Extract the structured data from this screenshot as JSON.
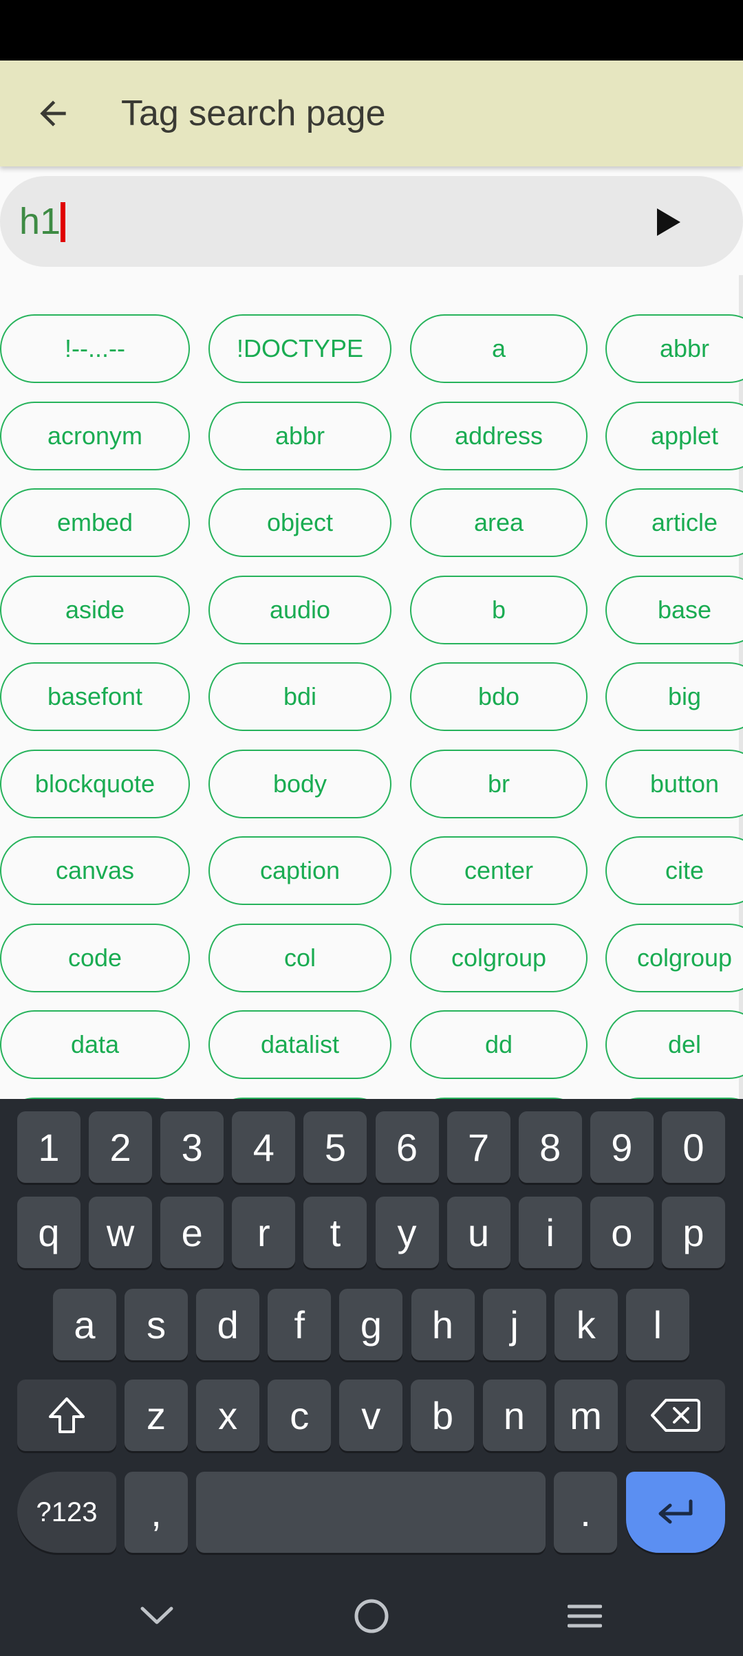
{
  "app_bar": {
    "title": "Tag search page",
    "back_icon": "arrow-left-icon"
  },
  "search": {
    "value": "h1",
    "submit_icon": "play-icon"
  },
  "tags": [
    "!--...--",
    "!DOCTYPE",
    "a",
    "abbr",
    "acronym",
    "abbr",
    "address",
    "applet",
    "embed",
    "object",
    "area",
    "article",
    "aside",
    "audio",
    "b",
    "base",
    "basefont",
    "bdi",
    "bdo",
    "big",
    "blockquote",
    "body",
    "br",
    "button",
    "canvas",
    "caption",
    "center",
    "cite",
    "code",
    "col",
    "colgroup",
    "colgroup",
    "data",
    "datalist",
    "dd",
    "del"
  ],
  "keyboard": {
    "row_numbers": [
      "1",
      "2",
      "3",
      "4",
      "5",
      "6",
      "7",
      "8",
      "9",
      "0"
    ],
    "row_1": [
      "q",
      "w",
      "e",
      "r",
      "t",
      "y",
      "u",
      "i",
      "o",
      "p"
    ],
    "row_2": [
      "a",
      "s",
      "d",
      "f",
      "g",
      "h",
      "j",
      "k",
      "l"
    ],
    "row_3": [
      "z",
      "x",
      "c",
      "v",
      "b",
      "n",
      "m"
    ],
    "symbols_label": "?123",
    "comma_label": ",",
    "period_label": ".",
    "shift_icon": "shift-icon",
    "backspace_icon": "backspace-icon",
    "enter_icon": "enter-icon"
  },
  "nav_bar": {
    "icons": [
      "chevron-down-icon",
      "home-circle-icon",
      "menu-icon"
    ]
  },
  "colors": {
    "app_bar": "#e6e6c0",
    "tag_text": "#1aac52",
    "tag_border": "#27b35c",
    "caret": "#e00000",
    "search_text": "#3e8b44",
    "enter_key": "#5b8ff2"
  }
}
